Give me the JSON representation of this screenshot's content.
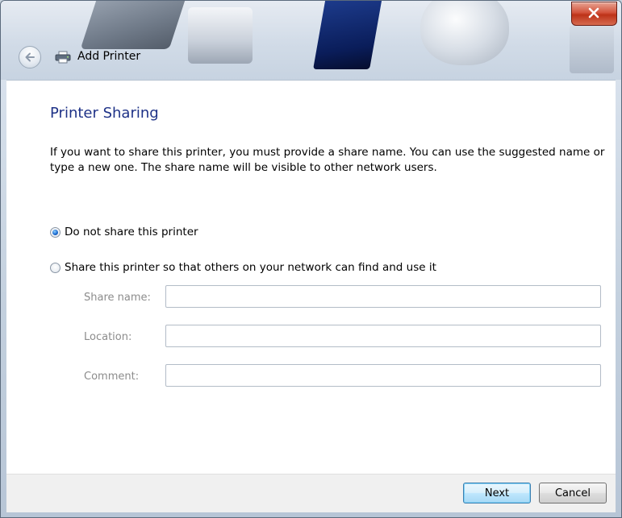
{
  "window": {
    "title": "Add Printer"
  },
  "page": {
    "heading": "Printer Sharing",
    "description": "If you want to share this printer, you must provide a share name. You can use the suggested name or type a new one. The share name will be visible to other network users."
  },
  "sharing_options": [
    {
      "label": "Do not share this printer",
      "selected": true
    },
    {
      "label": "Share this printer so that others on your network can find and use it",
      "selected": false
    }
  ],
  "fields": {
    "share_name": {
      "label": "Share name:",
      "value": ""
    },
    "location": {
      "label": "Location:",
      "value": ""
    },
    "comment": {
      "label": "Comment:",
      "value": ""
    }
  },
  "buttons": {
    "next": "Next",
    "cancel": "Cancel"
  },
  "icons": {
    "back": "back-arrow-icon",
    "title": "printer-icon",
    "close": "close-icon"
  },
  "colors": {
    "heading": "#1e3287",
    "close_button": "#c7402a",
    "disabled_label": "#8c8c8c"
  }
}
